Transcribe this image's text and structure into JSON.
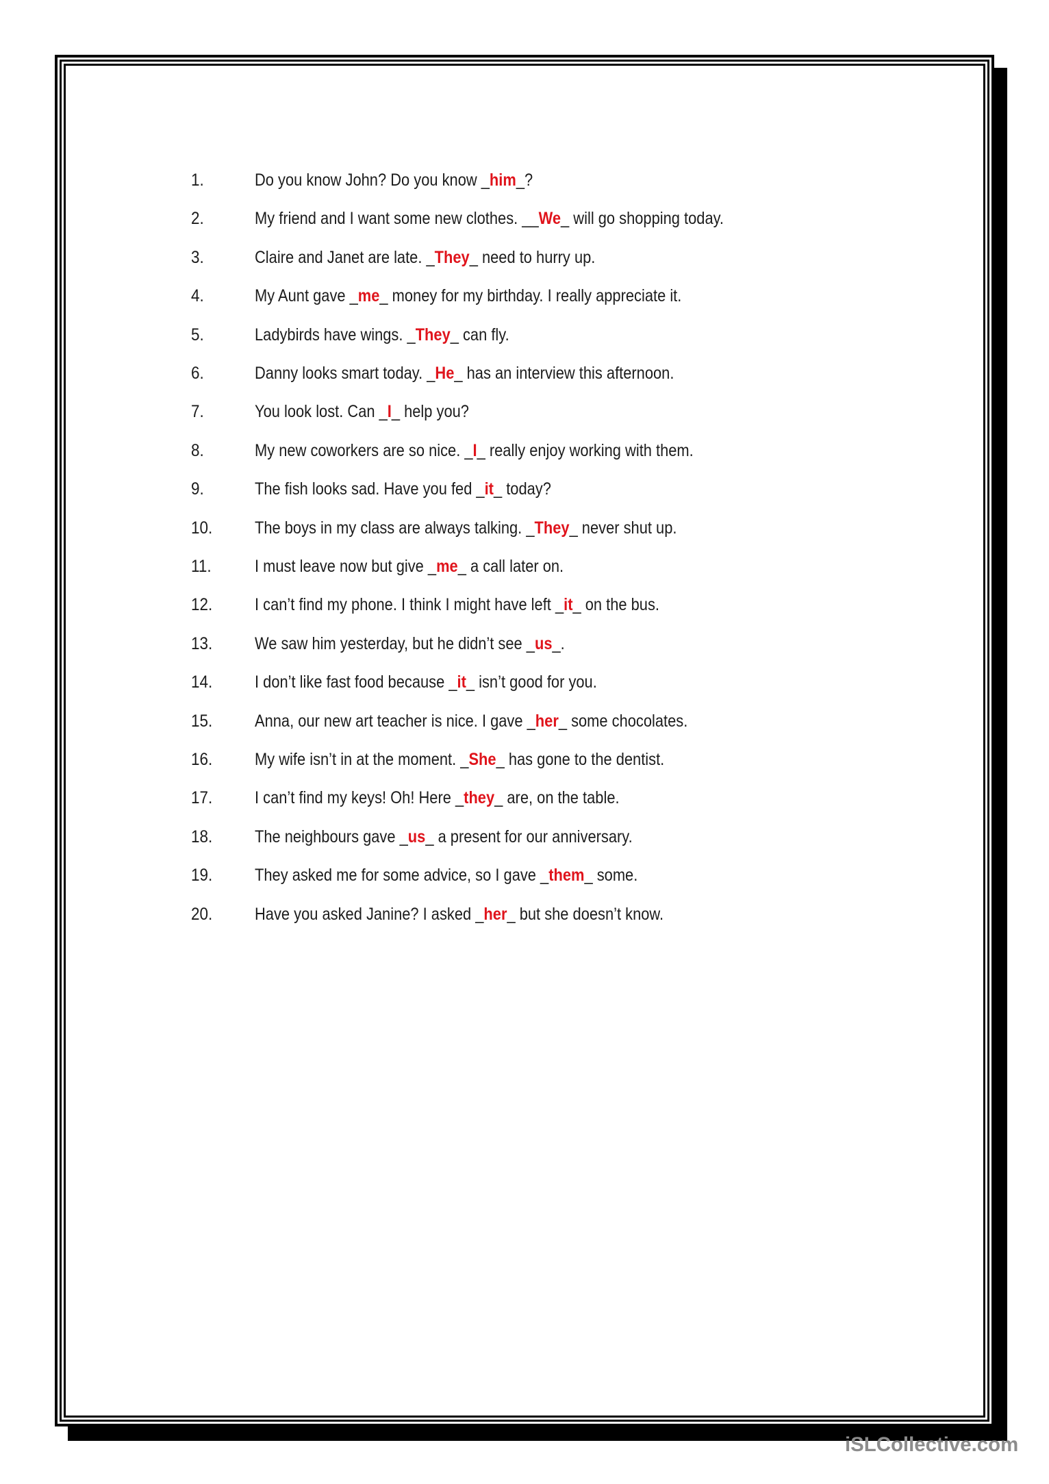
{
  "worksheet": {
    "items": [
      {
        "number": "1.",
        "before": "Do you know John? Do you know _",
        "answer": "him",
        "after": "_?"
      },
      {
        "number": "2.",
        "before": "My friend and I want some new clothes. __",
        "answer": "We",
        "after": "_ will go shopping today."
      },
      {
        "number": "3.",
        "before": "Claire and Janet are late. _",
        "answer": "They",
        "after": "_ need to hurry up."
      },
      {
        "number": "4.",
        "before": "My Aunt gave _",
        "answer": "me",
        "after": "_ money for my birthday. I really appreciate it."
      },
      {
        "number": "5.",
        "before": "Ladybirds have wings. _",
        "answer": "They",
        "after": "_ can fly."
      },
      {
        "number": "6.",
        "before": "Danny looks smart today. _",
        "answer": "He",
        "after": "_ has an interview this afternoon."
      },
      {
        "number": "7.",
        "before": "You look lost. Can _",
        "answer": "I",
        "after": "_ help you?"
      },
      {
        "number": "8.",
        "before": "My new coworkers are so nice. _",
        "answer": "I",
        "after": "_ really enjoy working with them."
      },
      {
        "number": "9.",
        "before": "The fish looks sad. Have you fed _",
        "answer": "it",
        "after": "_ today?"
      },
      {
        "number": "10.",
        "before": "The boys in my class are always talking. _",
        "answer": "They",
        "after": "_ never shut up."
      },
      {
        "number": "11.",
        "before": "I must leave now but give _",
        "answer": "me",
        "after": "_ a call later on."
      },
      {
        "number": "12.",
        "before": "I can’t find my phone. I think I might have left _",
        "answer": "it",
        "after": "_ on the bus."
      },
      {
        "number": "13.",
        "before": "We saw him yesterday, but he didn’t see _",
        "answer": "us",
        "after": "_."
      },
      {
        "number": "14.",
        "before": "I don’t like fast food because _",
        "answer": "it",
        "after": "_ isn’t good for you."
      },
      {
        "number": "15.",
        "before": "Anna, our new art teacher is nice. I gave _",
        "answer": "her",
        "after": "_ some chocolates."
      },
      {
        "number": "16.",
        "before": "My wife isn’t in at the moment. _",
        "answer": "She",
        "after": "_ has gone to the dentist."
      },
      {
        "number": "17.",
        "before": "I can’t find my keys! Oh! Here _",
        "answer": "they",
        "after": "_ are, on the table."
      },
      {
        "number": "18.",
        "before": "The neighbours gave _",
        "answer": "us",
        "after": "_ a present for our anniversary."
      },
      {
        "number": "19.",
        "before": "They asked me for some advice, so I gave _",
        "answer": "them",
        "after": "_ some."
      },
      {
        "number": "20.",
        "before": "Have you asked Janine? I asked _",
        "answer": "her",
        "after": "_ but she doesn’t know."
      }
    ]
  },
  "colors": {
    "answer": "#e0141c",
    "text": "#1c1c1c",
    "watermark": "#8c8c8c"
  },
  "watermark": "iSLCollective.com"
}
